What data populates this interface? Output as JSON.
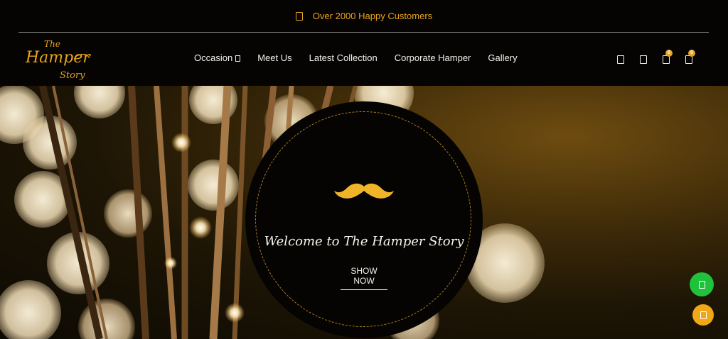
{
  "topbar": {
    "text": "Over 2000 Happy Customers",
    "icon": "gift-icon"
  },
  "logo": {
    "line1": "The",
    "line2": "Hamper",
    "line3": "Story"
  },
  "nav": {
    "items": [
      {
        "label": "Occasion",
        "has_dropdown": true
      },
      {
        "label": "Meet Us"
      },
      {
        "label": "Latest Collection"
      },
      {
        "label": "Corporate Hamper"
      },
      {
        "label": "Gallery"
      }
    ]
  },
  "header_icons": [
    {
      "name": "search-icon"
    },
    {
      "name": "user-icon"
    },
    {
      "name": "wishlist-icon",
      "badge": "0"
    },
    {
      "name": "cart-icon",
      "badge": "0"
    }
  ],
  "hero": {
    "welcome": "Welcome to The Hamper Story",
    "cta": "Show Now",
    "icon": "mustache-icon"
  },
  "fabs": [
    {
      "name": "whatsapp-button",
      "color": "#1fc23a"
    },
    {
      "name": "chat-button",
      "color": "#f0a818"
    }
  ],
  "colors": {
    "accent": "#e7a31c",
    "background": "#050403",
    "text": "#f2efe9"
  }
}
